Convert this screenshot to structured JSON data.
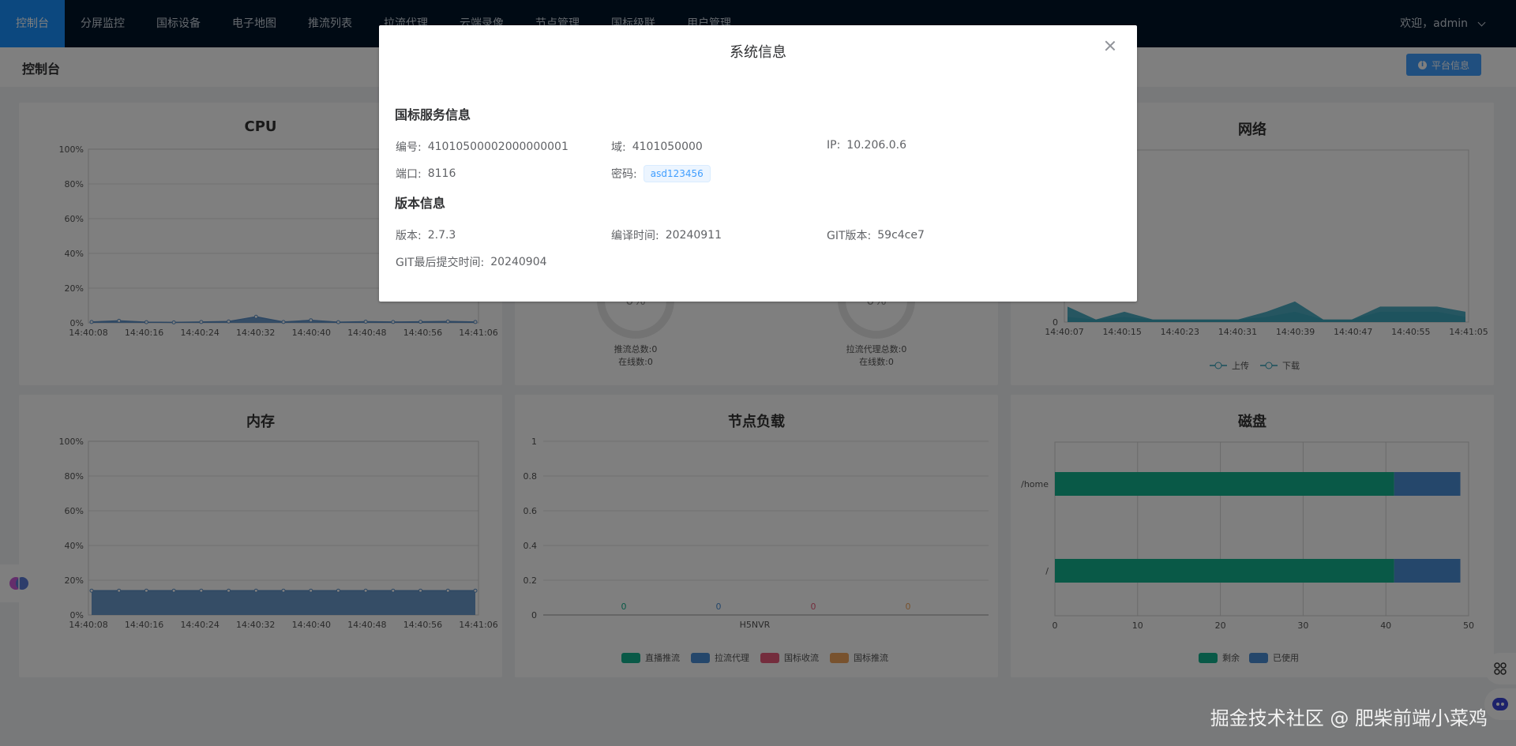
{
  "nav": {
    "items": [
      {
        "label": "控制台",
        "active": true
      },
      {
        "label": "分屏监控"
      },
      {
        "label": "国标设备"
      },
      {
        "label": "电子地图"
      },
      {
        "label": "推流列表"
      },
      {
        "label": "拉流代理"
      },
      {
        "label": "云端录像"
      },
      {
        "label": "节点管理"
      },
      {
        "label": "国标级联"
      },
      {
        "label": "用户管理"
      }
    ],
    "user_greeting": "欢迎，admin"
  },
  "subbar": {
    "title": "控制台",
    "platform_button": "平台信息"
  },
  "cards": {
    "cpu": {
      "title": "CPU"
    },
    "media": {
      "push_total_label": "推流总数:0",
      "push_online_label": "在线数:0",
      "proxy_total_label": "拉流代理总数:0",
      "proxy_online_label": "在线数:0",
      "gauge_value": "0%"
    },
    "network": {
      "title": "网络"
    },
    "memory": {
      "title": "内存"
    },
    "node_load": {
      "title": "节点负载"
    },
    "disk": {
      "title": "磁盘"
    }
  },
  "chart_data": [
    {
      "id": "cpu",
      "type": "area",
      "title": "CPU",
      "x": [
        "14:40:08",
        "14:40:12",
        "14:40:16",
        "14:40:20",
        "14:40:24",
        "14:40:28",
        "14:40:32",
        "14:40:36",
        "14:40:40",
        "14:40:44",
        "14:40:48",
        "14:40:52",
        "14:40:56",
        "14:41:00",
        "14:41:06"
      ],
      "x_ticks": [
        "14:40:08",
        "14:40:16",
        "14:40:24",
        "14:40:32",
        "14:40:40",
        "14:40:48",
        "14:40:56",
        "14:41:06"
      ],
      "values": [
        0.5,
        1.2,
        0.4,
        0.3,
        0.5,
        0.8,
        3.5,
        0.5,
        1.5,
        0.4,
        0.7,
        0.5,
        0.6,
        0.8,
        0.5
      ],
      "y_ticks": [
        "0%",
        "20%",
        "40%",
        "60%",
        "80%",
        "100%"
      ],
      "ylim": [
        0,
        100
      ],
      "color": "#5b8fc7"
    },
    {
      "id": "network",
      "type": "area",
      "title": "网络",
      "x": [
        "14:40:07",
        "14:40:11",
        "14:40:15",
        "14:40:19",
        "14:40:23",
        "14:40:27",
        "14:40:31",
        "14:40:35",
        "14:40:39",
        "14:40:43",
        "14:40:47",
        "14:40:51",
        "14:40:55",
        "14:40:59",
        "14:41:05"
      ],
      "x_ticks": [
        "14:40:07",
        "14:40:15",
        "14:40:23",
        "14:40:31",
        "14:40:39",
        "14:40:47",
        "14:40:55",
        "14:41:05"
      ],
      "series": [
        {
          "name": "上传",
          "values": [
            3,
            0.5,
            2,
            0.5,
            0.5,
            0.5,
            0.5,
            2,
            4,
            0.5,
            0.5,
            3,
            3,
            3,
            2
          ]
        },
        {
          "name": "下载",
          "values": [
            1,
            0.5,
            1,
            0.5,
            0.5,
            0.5,
            0.5,
            1,
            2,
            0.5,
            0.5,
            2,
            2,
            2,
            1
          ]
        }
      ],
      "y_ticks": [
        "0"
      ],
      "ylim": [
        0,
        100
      ],
      "legend": "bottom",
      "color": "#2e9fb7"
    },
    {
      "id": "memory",
      "type": "area",
      "title": "内存",
      "x": [
        "14:40:08",
        "14:40:12",
        "14:40:16",
        "14:40:20",
        "14:40:24",
        "14:40:28",
        "14:40:32",
        "14:40:36",
        "14:40:40",
        "14:40:44",
        "14:40:48",
        "14:40:52",
        "14:40:56",
        "14:41:00",
        "14:41:06"
      ],
      "x_ticks": [
        "14:40:08",
        "14:40:16",
        "14:40:24",
        "14:40:32",
        "14:40:40",
        "14:40:48",
        "14:40:56",
        "14:41:06"
      ],
      "values": [
        14,
        14,
        14,
        14,
        14,
        14,
        14,
        14,
        14,
        14,
        14,
        14,
        14,
        14,
        14
      ],
      "y_ticks": [
        "0%",
        "20%",
        "40%",
        "60%",
        "80%",
        "100%"
      ],
      "ylim": [
        0,
        100
      ],
      "color": "#5b8fc7"
    },
    {
      "id": "node_load",
      "type": "bar",
      "title": "节点负载",
      "categories": [
        "H5NVR"
      ],
      "series": [
        {
          "name": "直播推流",
          "values": [
            0
          ],
          "color": "#13b38f"
        },
        {
          "name": "拉流代理",
          "values": [
            0
          ],
          "color": "#4a8fd6"
        },
        {
          "name": "国标收流",
          "values": [
            0
          ],
          "color": "#e85a7a"
        },
        {
          "name": "国标推流",
          "values": [
            0
          ],
          "color": "#f0a45c"
        }
      ],
      "y_ticks": [
        "0",
        "0.2",
        "0.4",
        "0.6",
        "0.8",
        "1"
      ],
      "ylim": [
        0,
        1
      ],
      "legend": "bottom"
    },
    {
      "id": "disk",
      "type": "bar",
      "orientation": "horizontal",
      "title": "磁盘",
      "categories": [
        "/home",
        "/"
      ],
      "series": [
        {
          "name": "剩余",
          "values": [
            41,
            41
          ],
          "color": "#13b38f"
        },
        {
          "name": "已使用",
          "values": [
            8,
            8
          ],
          "color": "#4a8fd6"
        }
      ],
      "x_ticks": [
        "0",
        "10",
        "20",
        "30",
        "40",
        "50"
      ],
      "xlim": [
        0,
        50
      ],
      "legend": "bottom"
    }
  ],
  "dialog": {
    "title": "系统信息",
    "gb_section_title": "国标服务信息",
    "gb": {
      "id_label": "编号:",
      "id_value": "41010500002000000001",
      "domain_label": "域:",
      "domain_value": "4101050000",
      "ip_label": "IP:",
      "ip_value": "10.206.0.6",
      "port_label": "端口:",
      "port_value": "8116",
      "password_label": "密码:",
      "password_value": "asd123456"
    },
    "version_section_title": "版本信息",
    "version": {
      "version_label": "版本:",
      "version_value": "2.7.3",
      "build_time_label": "编译时间:",
      "build_time_value": "20240911",
      "git_label": "GIT版本:",
      "git_value": "59c4ce7",
      "git_commit_time_label": "GIT最后提交时间:",
      "git_commit_time_value": "20240904"
    }
  },
  "watermark": "掘金技术社区 @ 肥柴前端小菜鸡"
}
